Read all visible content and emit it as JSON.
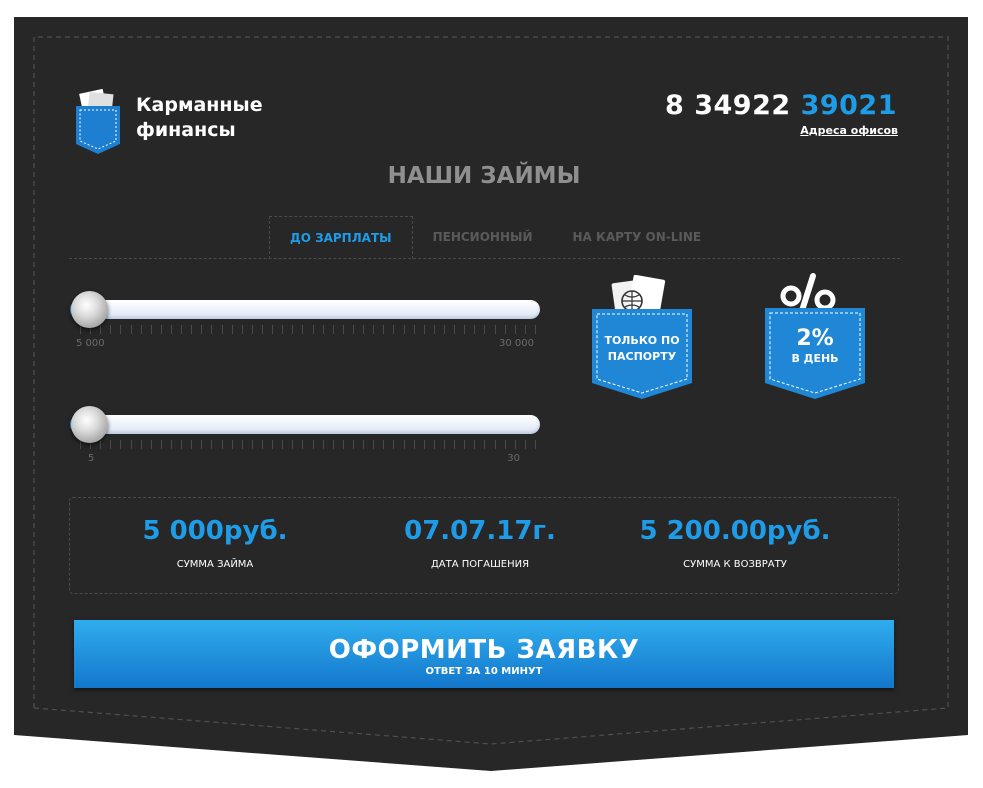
{
  "brand": {
    "name_line1": "Карманные",
    "name_line2": "финансы"
  },
  "contacts": {
    "phone_code": "8 34922",
    "phone_number": "39021",
    "offices_link": "Адреса офисов"
  },
  "section_title": "НАШИ ЗАЙМЫ",
  "tabs": [
    {
      "label": "ДО ЗАРПЛАТЫ",
      "active": true
    },
    {
      "label": "ПЕНСИОННЫЙ",
      "active": false
    },
    {
      "label": "НА КАРТУ ON-LINE",
      "active": false
    }
  ],
  "sliders": {
    "amount": {
      "min_label": "5 000",
      "max_label": "30 000",
      "min": 5000,
      "max": 30000,
      "value": 5000
    },
    "days": {
      "min_label": "5",
      "max_label": "30",
      "min": 5,
      "max": 30,
      "value": 5
    }
  },
  "badges": {
    "passport": {
      "line1": "ТОЛЬКО ПО",
      "line2": "ПАСПОРТУ",
      "icon": "passport-icon"
    },
    "rate": {
      "value": "2%",
      "line2": "В ДЕНЬ",
      "icon": "percent-icon"
    }
  },
  "summary": [
    {
      "value": "5 000руб.",
      "label": "СУММА ЗАЙМА"
    },
    {
      "value": "07.07.17г.",
      "label": "ДАТА ПОГАШЕНИЯ"
    },
    {
      "value": "5 200.00руб.",
      "label": "СУММА К ВОЗВРАТУ"
    }
  ],
  "cta": {
    "label": "ОФОРМИТЬ ЗАЯВКУ",
    "sublabel": "ОТВЕТ ЗА 10 МИНУТ"
  },
  "colors": {
    "accent": "#1f9ce8",
    "background": "#272727",
    "stitch": "#4a4a4a",
    "title_gray": "#8f8f8f"
  }
}
